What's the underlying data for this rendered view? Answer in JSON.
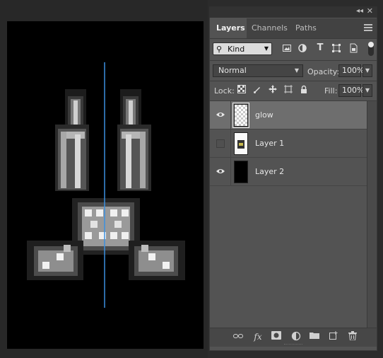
{
  "canvas": {
    "guide_color": "#3b8fe0"
  },
  "panel": {
    "collapse_glyph": "◂◂",
    "close_glyph": "✕",
    "tabs": [
      {
        "label": "Layers",
        "active": true
      },
      {
        "label": "Channels",
        "active": false
      },
      {
        "label": "Paths",
        "active": false
      }
    ],
    "filter": {
      "kind_label": "Kind",
      "icons": [
        "image-filter-icon",
        "adjustment-filter-icon",
        "type-filter-icon",
        "shape-filter-icon",
        "smart-object-filter-icon"
      ],
      "type_glyph": "T"
    },
    "blend_mode": "Normal",
    "opacity_label": "Opacity:",
    "opacity_value": "100%",
    "lock_label": "Lock:",
    "fill_label": "Fill:",
    "fill_value": "100%",
    "layers": [
      {
        "name": "glow",
        "visible": true,
        "selected": true
      },
      {
        "name": "Layer 1",
        "visible": false,
        "selected": false
      },
      {
        "name": "Layer 2",
        "visible": true,
        "selected": false
      }
    ],
    "footer_icons": [
      "link-layers-icon",
      "fx-icon",
      "mask-icon",
      "adjustment-layer-icon",
      "group-folder-icon",
      "new-layer-icon",
      "trash-icon"
    ],
    "fx_label": "fx"
  }
}
